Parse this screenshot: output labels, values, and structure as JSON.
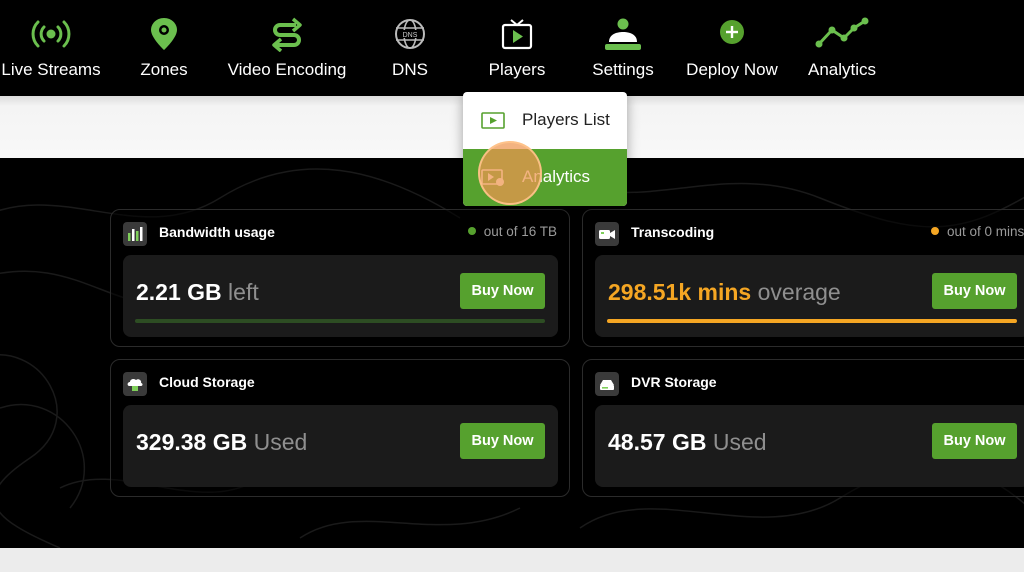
{
  "nav": {
    "items": [
      {
        "label": "Live Streams",
        "icon": "broadcast-icon"
      },
      {
        "label": "Zones",
        "icon": "map-pin-icon"
      },
      {
        "label": "Video Encoding",
        "icon": "transcode-arrows-icon"
      },
      {
        "label": "DNS",
        "icon": "globe-dns-icon"
      },
      {
        "label": "Players",
        "icon": "tv-play-icon"
      },
      {
        "label": "Settings",
        "icon": "user-settings-icon"
      },
      {
        "label": "Deploy Now",
        "icon": "plus-circle-icon"
      },
      {
        "label": "Analytics",
        "icon": "line-chart-icon"
      }
    ],
    "dns_icon_text": "DNS"
  },
  "dropdown": {
    "items": [
      {
        "label": "Players List",
        "icon": "play-window-icon",
        "active": false
      },
      {
        "label": "Analytics",
        "icon": "player-analytics-icon",
        "active": true
      }
    ]
  },
  "cards": {
    "bandwidth": {
      "title": "Bandwidth usage",
      "limit": "out of 16 TB",
      "value": "2.21 GB",
      "unit": "left",
      "button": "Buy Now",
      "progress": 1.0,
      "status_color": "#56a12e"
    },
    "transcoding": {
      "title": "Transcoding",
      "limit": "out of 0 mins",
      "value": "298.51k mins",
      "unit": "overage",
      "button": "Buy Now",
      "progress": 1.0,
      "status_color": "#f5a623"
    },
    "cloud": {
      "title": "Cloud Storage",
      "value": "329.38 GB",
      "unit": "Used",
      "button": "Buy Now"
    },
    "dvr": {
      "title": "DVR Storage",
      "value": "48.57 GB",
      "unit": "Used",
      "button": "Buy Now"
    }
  },
  "colors": {
    "accent": "#56a12e",
    "warning": "#f5a623",
    "background": "#000000"
  }
}
